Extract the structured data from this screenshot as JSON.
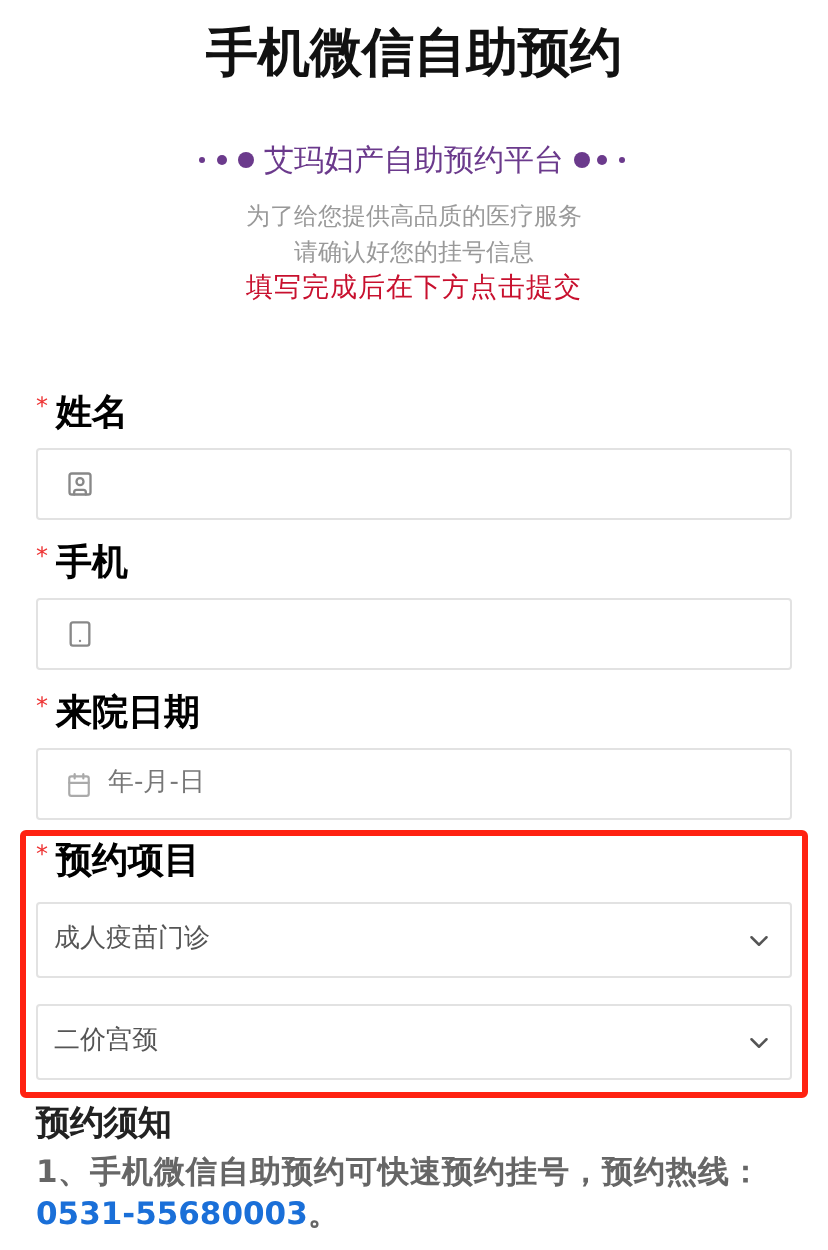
{
  "title": "手机微信自助预约",
  "subtitle": {
    "text": "艾玛妇产自助预约平台"
  },
  "intro": {
    "lines": [
      "为了给您提供高品质的医疗服务",
      "请确认好您的挂号信息"
    ],
    "highlight": "填写完成后在下方点击提交"
  },
  "fields": [
    {
      "kind": "name",
      "required_mark": "*",
      "label": "姓名"
    },
    {
      "kind": "phone",
      "required_mark": "*",
      "label": "手机"
    },
    {
      "kind": "date",
      "required_mark": "*",
      "label": "来院日期",
      "placeholder": "年-月-日"
    }
  ],
  "project": {
    "required_mark": "*",
    "label": "预约项目",
    "highlighted": true,
    "selects": [
      {
        "value": "成人疫苗门诊"
      },
      {
        "value": "二价宫颈"
      }
    ]
  },
  "notice": {
    "title": "预约须知",
    "text": "1、手机微信自助预约可快速预约挂号，预约热线：",
    "phone": "0531-55680003",
    "text_after": "。"
  }
}
